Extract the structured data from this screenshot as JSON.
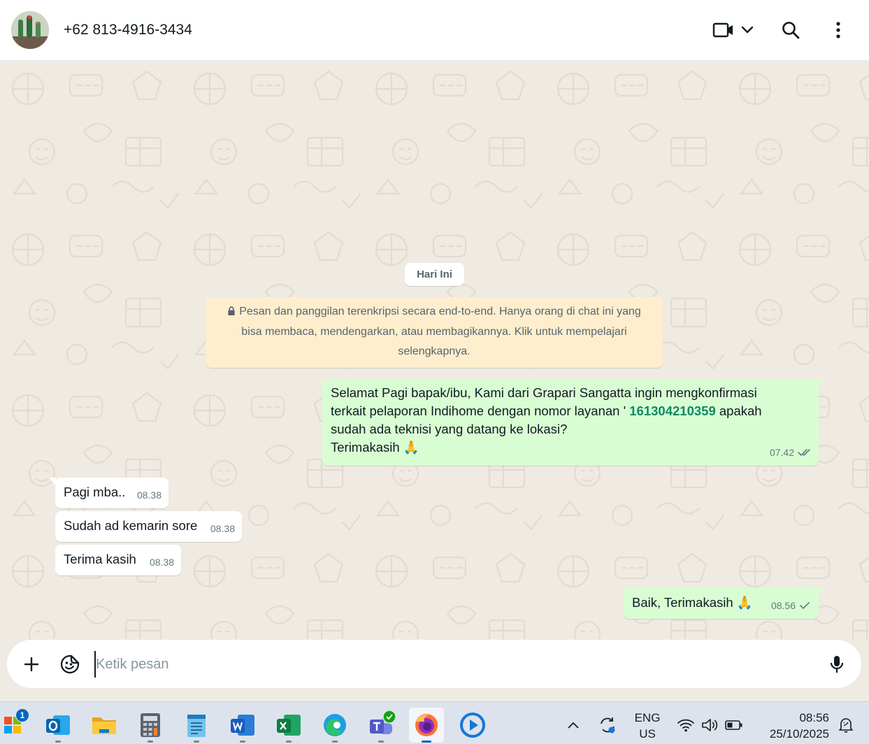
{
  "header": {
    "contact_name": "+62 813-4916-3434"
  },
  "chat": {
    "day_label": "Hari Ini",
    "encryption_notice": "Pesan dan panggilan terenkripsi secara end-to-end. Hanya orang di chat ini yang bisa membaca, mendengarkan, atau membagikannya. Klik untuk mempelajari selengkapnya.",
    "messages": [
      {
        "direction": "outgoing",
        "text_line1": "Selamat Pagi bapak/ibu, Kami dari Grapari Sangatta ingin mengkonfirmasi",
        "text_line2_pre": "terkait pelaporan Indihome dengan nomor layanan ' ",
        "service_number": "161304210359",
        "text_line2_post": " apakah",
        "text_line3": "sudah ada teknisi yang datang ke lokasi?",
        "text_line4": "Terimakasih",
        "emoji": "🙏",
        "time": "07.42",
        "status": "read"
      },
      {
        "direction": "incoming",
        "text": "Pagi mba..",
        "time": "08.38"
      },
      {
        "direction": "incoming",
        "text": "Sudah ad kemarin sore",
        "time": "08.38"
      },
      {
        "direction": "incoming",
        "text": "Terima kasih",
        "time": "08.38"
      },
      {
        "direction": "outgoing",
        "text": "Baik, Terimakasih",
        "emoji": "🙏",
        "time": "08.56",
        "status": "sent"
      }
    ]
  },
  "composer": {
    "placeholder": "Ketik pesan"
  },
  "taskbar": {
    "start_badge": "1",
    "apps": [
      "Outlook",
      "File Explorer",
      "Calculator",
      "Notepad",
      "Word",
      "Excel",
      "Edge",
      "Teams",
      "Firefox",
      "Media Player"
    ],
    "active_app": "Firefox",
    "language_line1": "ENG",
    "language_line2": "US",
    "time": "08:56",
    "date": "25/10/2025"
  },
  "colors": {
    "outgoing_bubble": "#d9fdd3",
    "incoming_bubble": "#ffffff",
    "chat_background": "#efeae2",
    "encryption_notice_bg": "#ffeecd",
    "link_number": "#0f8a62"
  }
}
